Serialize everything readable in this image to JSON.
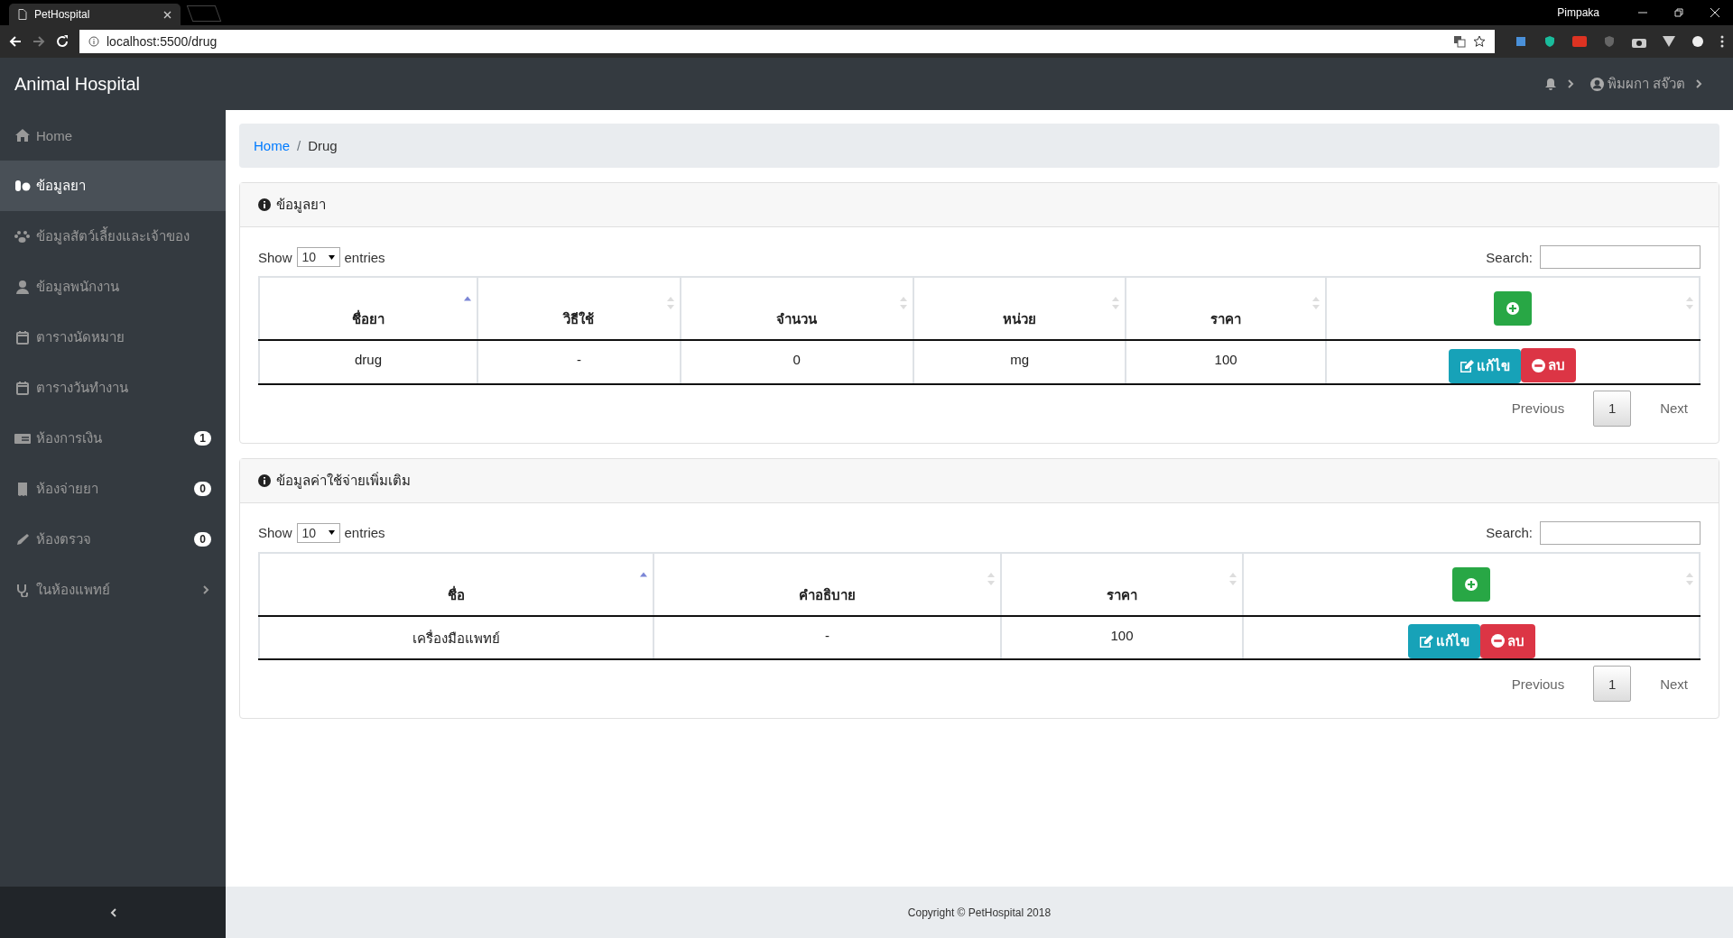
{
  "browser": {
    "tab_title": "PetHospital",
    "profile": "Pimpaka",
    "url": "localhost:5500/drug"
  },
  "navbar": {
    "brand": "Animal Hospital",
    "user": "พิมผกา สจ๊วต"
  },
  "sidebar": {
    "items": [
      {
        "label": "Home",
        "selected": false
      },
      {
        "label": "ข้อมูลยา",
        "selected": true
      },
      {
        "label": "ข้อมูลสัตว์เลี้ยงและเจ้าของ",
        "selected": false
      },
      {
        "label": "ข้อมูลพนักงาน",
        "selected": false
      },
      {
        "label": "ตารางนัดหมาย",
        "selected": false
      },
      {
        "label": "ตารางวันทำงาน",
        "selected": false
      },
      {
        "label": "ห้องการเงิน",
        "selected": false,
        "badge": "1"
      },
      {
        "label": "ห้องจ่ายยา",
        "selected": false,
        "badge": "0"
      },
      {
        "label": "ห้องตรวจ",
        "selected": false,
        "badge": "0"
      },
      {
        "label": "ในห้องแพทย์",
        "selected": false,
        "submenu": true
      }
    ]
  },
  "breadcrumb": [
    "Home",
    "Drug"
  ],
  "breadcrumb_separator": "/",
  "cards": [
    {
      "title": "ข้อมูลยา",
      "show_label": "Show",
      "page_size": "10",
      "entries_label": "entries",
      "search_label": "Search:",
      "columns": [
        {
          "label": "ชื่อยา",
          "sorted": true
        },
        {
          "label": "วิธีใช้",
          "sorted": false
        },
        {
          "label": "จำนวน",
          "sorted": false
        },
        {
          "label": "หน่วย",
          "sorted": false
        },
        {
          "label": "ราคา",
          "sorted": false
        }
      ],
      "rows": [
        [
          "drug",
          "-",
          "0",
          "mg",
          "100"
        ]
      ],
      "edit_label": "แก้ไข",
      "delete_label": "ลบ",
      "previous": "Previous",
      "page": "1",
      "next": "Next"
    },
    {
      "title": "ข้อมูลค่าใช้จ่ายเพิ่มเติม",
      "show_label": "Show",
      "page_size": "10",
      "entries_label": "entries",
      "search_label": "Search:",
      "columns": [
        {
          "label": "ชื่อ",
          "sorted": true
        },
        {
          "label": "คำอธิบาย",
          "sorted": false
        },
        {
          "label": "ราคา",
          "sorted": false
        }
      ],
      "rows": [
        [
          "เครื่องมือแพทย์",
          "-",
          "100"
        ]
      ],
      "edit_label": "แก้ไข",
      "delete_label": "ลบ",
      "previous": "Previous",
      "page": "1",
      "next": "Next"
    }
  ],
  "footer": "Copyright © PetHospital 2018"
}
